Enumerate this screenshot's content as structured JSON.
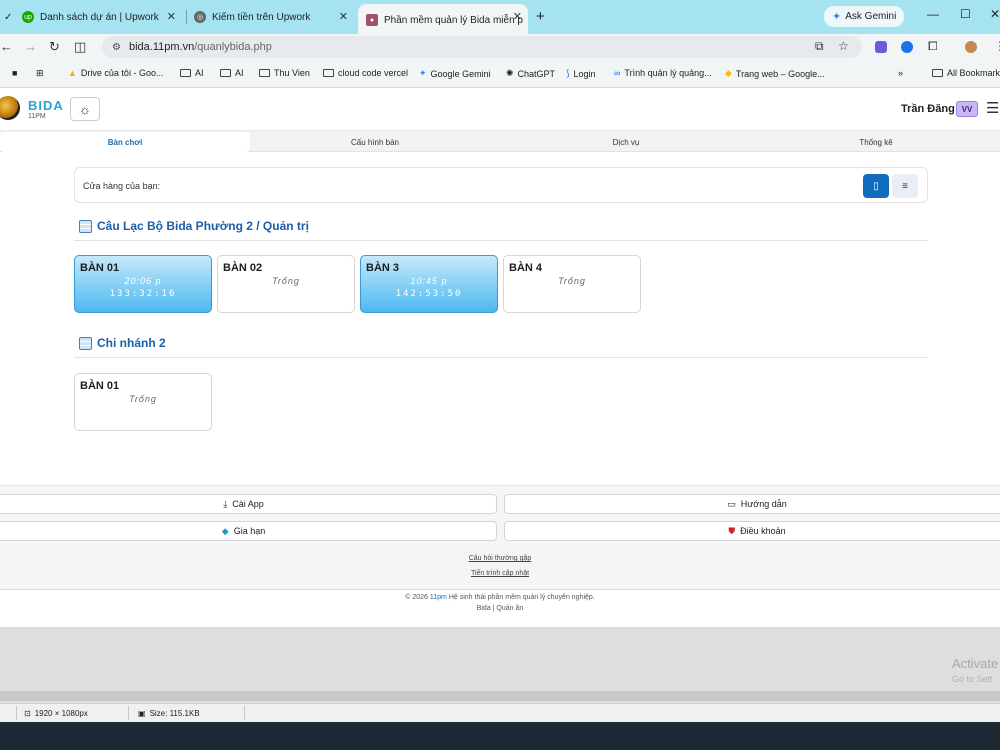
{
  "browser": {
    "tabs": [
      {
        "title": "Danh sách dự án | Upwork",
        "active": false
      },
      {
        "title": "Kiếm tiền trên Upwork",
        "active": false
      },
      {
        "title": "Phần mềm quản lý Bida miễn p",
        "active": true
      }
    ],
    "new_tab": "+",
    "gemini_label": "Ask Gemini",
    "url_domain": "bida.11pm.vn",
    "url_path": "/quanlybida.php",
    "bookmarks": [
      "Drive của tôi - Goo...",
      "AI",
      "AI",
      "Thu Vien",
      "cloud code vercel",
      "Google Gemini",
      "ChatGPT",
      "Login",
      "Trình quản lý quảng...",
      "Trang web – Google..."
    ],
    "bookmarks_more": "»",
    "all_bookmarks": "All Bookmark"
  },
  "app": {
    "logo_text": "BIDA",
    "logo_sub": "11PM",
    "username": "Trần Đăng",
    "user_badge": "VV",
    "tabs": [
      {
        "label": "Bàn chơi",
        "active": true
      },
      {
        "label": "Cấu hình bàn",
        "active": false
      },
      {
        "label": "Dịch vụ",
        "active": false
      },
      {
        "label": "Thống kê",
        "active": false
      }
    ],
    "store_label": "Cửa hàng của bạn:",
    "sections": [
      {
        "title": "Câu Lạc Bộ Bida Phường 2 / Quản trị",
        "tables": [
          {
            "name": "BÀN 01",
            "busy": true,
            "status": "20:06 p",
            "timer": "133:32:16"
          },
          {
            "name": "BÀN 02",
            "busy": false,
            "status": "Trống"
          },
          {
            "name": "BÀN 3",
            "busy": true,
            "status": "10:45 p",
            "timer": "142:53:50"
          },
          {
            "name": "BÀN 4",
            "busy": false,
            "status": "Trống"
          }
        ]
      },
      {
        "title": "Chi nhánh 2",
        "tables": [
          {
            "name": "BÀN 01",
            "busy": false,
            "status": "Trống"
          }
        ]
      }
    ],
    "footer": {
      "install_app": "Cài App",
      "guide": "Hướng dẫn",
      "renew": "Gia hạn",
      "terms": "Điều khoản",
      "faq": "Câu hỏi thường gặp",
      "changelog": "Tiến trình cập nhật",
      "copyright_prefix": "© 2026",
      "copyright_brand": "11pm",
      "copyright_suffix": "Hệ sinh thái phần mềm quản lý chuyên nghiệp.",
      "products": "Bida | Quán ăn"
    }
  },
  "os": {
    "activate_title": "Activate",
    "activate_sub": "Go to Sett",
    "resolution": "1920 × 1080px",
    "size": "Size: 115.1KB"
  }
}
